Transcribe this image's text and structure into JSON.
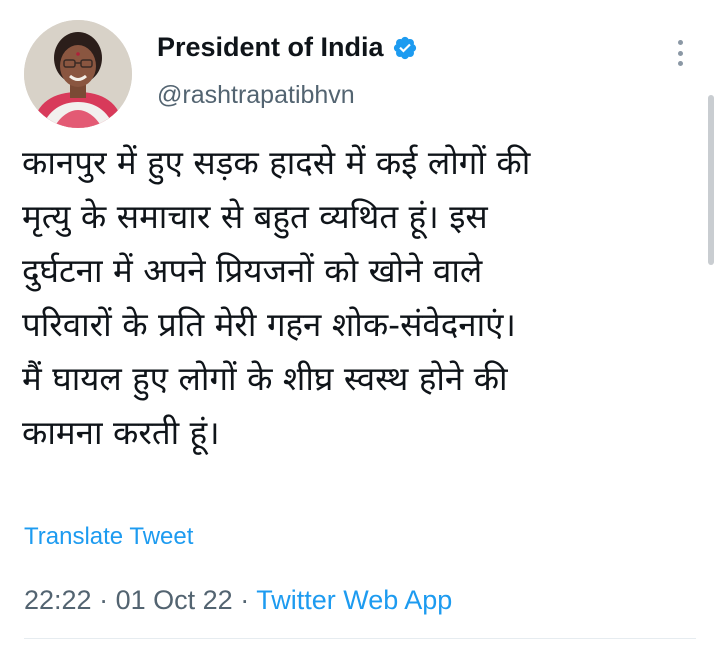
{
  "author": {
    "display_name": "President of India",
    "handle": "@rashtrapatibhvn",
    "verified_icon": "verified-badge-icon",
    "avatar": "profile-photo"
  },
  "tweet": {
    "lines": [
      "कानपुर में हुए सड़क हादसे में कई लोगों की",
      "मृत्यु के समाचार से बहुत व्यथित हूं। इस",
      "दुर्घटना में अपने प्रियजनों को खोने वाले",
      "परिवारों के प्रति मेरी गहन शोक-संवेदनाएं।",
      "मैं घायल हुए लोगों के शीघ्र स्वस्थ होने की",
      "कामना करती हूं।"
    ],
    "translate_label": "Translate Tweet",
    "time": "22:22",
    "separator": "·",
    "date": "01 Oct 22",
    "source": "Twitter Web App"
  },
  "colors": {
    "link": "#1d9bf0",
    "muted": "#536471",
    "text": "#0f1419"
  }
}
